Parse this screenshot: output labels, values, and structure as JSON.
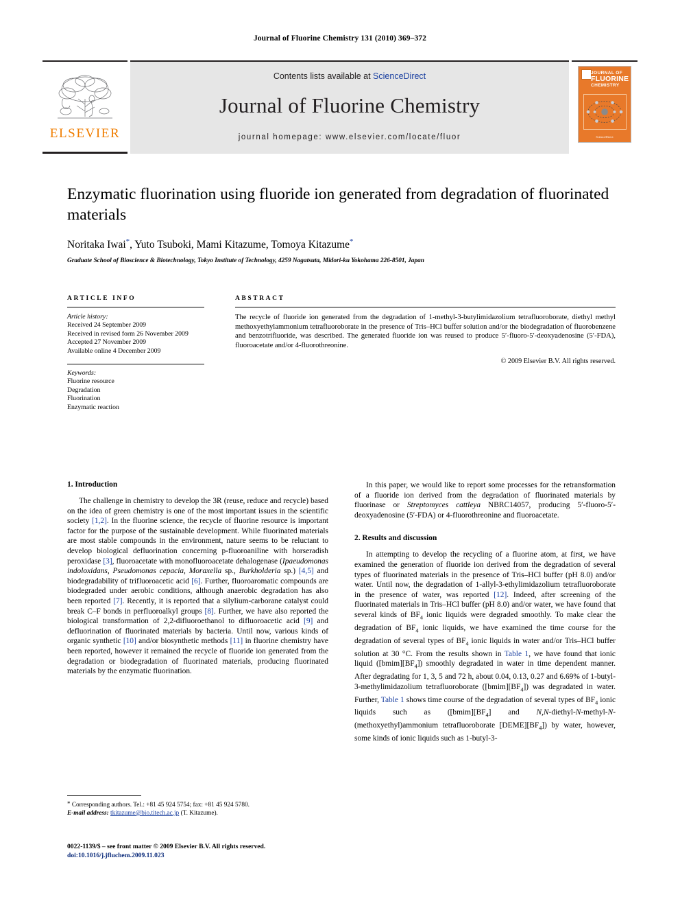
{
  "running_head": "Journal of Fluorine Chemistry 131 (2010) 369–372",
  "masthead": {
    "contents_prefix": "Contents lists available at ",
    "sciencedirect": "ScienceDirect",
    "journal_name": "Journal of Fluorine Chemistry",
    "homepage": "journal homepage: www.elsevier.com/locate/fluor",
    "publisher_wordmark": "ELSEVIER",
    "publisher_color": "#f07d00",
    "cover": {
      "line1": "JOURNAL OF",
      "line2": "FLUORINE",
      "line3": "CHEMISTRY",
      "footer": "ScienceDirect",
      "background_color": "#e8792a"
    }
  },
  "article": {
    "title": "Enzymatic fluorination using fluoride ion generated from degradation of fluorinated materials",
    "authors": "Noritaka Iwai *, Yuto Tsuboki, Mami Kitazume, Tomoya Kitazume *",
    "affiliation": "Graduate School of Bioscience & Biotechnology, Tokyo Institute of Technology, 4259 Nagatsuta, Midori-ku Yokohama 226-8501, Japan"
  },
  "article_info": {
    "label": "ARTICLE INFO",
    "history_label": "Article history:",
    "history": [
      "Received 24 September 2009",
      "Received in revised form 26 November 2009",
      "Accepted 27 November 2009",
      "Available online 4 December 2009"
    ],
    "keywords_label": "Keywords:",
    "keywords": [
      "Fluorine resource",
      "Degradation",
      "Fluorination",
      "Enzymatic reaction"
    ]
  },
  "abstract": {
    "label": "ABSTRACT",
    "text": "The recycle of fluoride ion generated from the degradation of 1-methyl-3-butylimidazolium tetrafluoroborate, diethyl methyl methoxyethylammonium tetrafluoroborate in the presence of Tris–HCl buffer solution and/or the biodegradation of fluorobenzene and benzotrifluoride, was described. The generated fluoride ion was reused to produce 5′-fluoro-5′-deoxyadenosine (5′-FDA), fluoroacetate and/or 4-fluorothreonine.",
    "copyright": "© 2009 Elsevier B.V. All rights reserved."
  },
  "sections": {
    "introduction_heading": "1. Introduction",
    "results_heading": "2. Results and discussion"
  },
  "body": {
    "left_p1_a": "The challenge in chemistry to develop the 3R (reuse, reduce and recycle) based on the idea of green chemistry is one of the most important issues in the scientific society ",
    "left_p1_cite1": "[1,2]",
    "left_p1_b": ". In the fluorine science, the recycle of fluorine resource is important factor for the purpose of the sustainable development. While fluorinated materials are most stable compounds in the environment, nature seems to be reluctant to develop biological defluorination concerning p-fluoroaniline with horseradish peroxidase ",
    "left_p1_cite2": "[3]",
    "left_p1_c": ", fluoroacetate with monofluoroacetate dehalogenase (",
    "left_p1_it1": "Ipaeudomonas indoloxidans, Pseudomonas cepacia, Moraxella",
    "left_p1_d": " sp., ",
    "left_p1_it2": "Burkholderia",
    "left_p1_e": " sp.) ",
    "left_p1_cite3": "[4,5]",
    "left_p1_f": " and biodegradability of trifluoroacetic acid ",
    "left_p1_cite4": "[6]",
    "left_p1_g": ". Further, fluoroaromatic compounds are biodegraded under aerobic conditions, although anaerobic degradation has also been reported ",
    "left_p1_cite5": "[7]",
    "left_p1_h": ". Recently, it is reported that a silylium-carborane catalyst could break C–F bonds in perfluoroalkyl groups ",
    "left_p1_cite6": "[8]",
    "left_p1_i": ". Further, we have also reported the biological transformation of 2,2-difluoroethanol to difluoroacetic acid ",
    "left_p1_cite7": "[9]",
    "left_p1_j": " and defluorination of fluorinated materials by bacteria. Until now, various kinds of organic synthetic ",
    "left_p1_cite8": "[10]",
    "left_p1_k": " and/or biosynthetic methods ",
    "left_p1_cite9": "[11]",
    "left_p1_l": " in fluorine chemistry have been reported, however it remained the recycle of fluoride ion generated from the degradation or biodegradation of fluorinated materials, producing fluorinated materials by the enzymatic fluorination.",
    "right_p1_a": "In this paper, we would like to report some processes for the retransformation of a fluoride ion derived from the degradation of fluorinated materials by fluorinase or ",
    "right_p1_it1": "Streptomyces cattleya",
    "right_p1_b": " NBRC14057, producing 5′-fluoro-5′-deoxyadenosine (5′-FDA) or 4-fluorothreonine and fluoroacetate.",
    "right_p2_a": "In attempting to develop the recycling of a fluorine atom, at first, we have examined the generation of fluoride ion derived from the degradation of several types of fluorinated materials in the presence of Tris–HCl buffer (pH 8.0) and/or water. Until now, the degradation of 1-allyl-3-ethylimidazolium tetrafluoroborate in the presence of water, was reported ",
    "right_p2_cite1": "[12]",
    "right_p2_b": ". Indeed, after screening of the fluorinated materials in Tris–HCl buffer (pH 8.0) and/or water, we have found that several kinds of BF",
    "right_p2_sub1": "4",
    "right_p2_c": " ionic liquids were degraded smoothly. To make clear the degradation of BF",
    "right_p2_sub2": "4",
    "right_p2_d": " ionic liquids, we have examined the time course for the degradation of several types of BF",
    "right_p2_sub3": "4",
    "right_p2_e": " ionic liquids in water and/or Tris–HCl buffer solution at 30 °C. From the results shown in ",
    "right_p2_link1": "Table 1",
    "right_p2_f": ", we have found that ionic liquid ([bmim][BF",
    "right_p2_sub4": "4",
    "right_p2_g": "]) smoothly degradated in water in time dependent manner. After degradating for 1, 3, 5 and 72 h, about 0.04, 0.13, 0.27 and 6.69% of 1-butyl-3-methylimidazolium tetrafluoroborate ([bmim][BF",
    "right_p2_sub5": "4",
    "right_p2_h": "]) was degradated in water. Further, ",
    "right_p2_link2": "Table 1",
    "right_p2_i": " shows time course of the degradation of several types of BF",
    "right_p2_sub6": "4",
    "right_p2_j": " ionic liquids such as ([bmim][BF",
    "right_p2_sub7": "4",
    "right_p2_k": "] and ",
    "right_p2_it1": "N,N",
    "right_p2_l": "-diethyl-",
    "right_p2_it2": "N",
    "right_p2_m": "-methyl-",
    "right_p2_it3": "N",
    "right_p2_n": "-(methoxyethyl)ammonium tetrafluoroborate [DEME][BF",
    "right_p2_sub8": "4",
    "right_p2_o": "]) by water, however, some kinds of ionic liquids such as 1-butyl-3-"
  },
  "footnotes": {
    "corresponding": "Corresponding authors. Tel.: +81 45 924 5754; fax: +81 45 924 5780.",
    "email_label": "E-mail address:",
    "email": "tkitazume@bio.titech.ac.jp",
    "email_owner": "(T. Kitazume).",
    "imprint": "0022-1139/$ – see front matter © 2009 Elsevier B.V. All rights reserved.",
    "doi": "doi:10.1016/j.jfluchem.2009.11.023"
  }
}
